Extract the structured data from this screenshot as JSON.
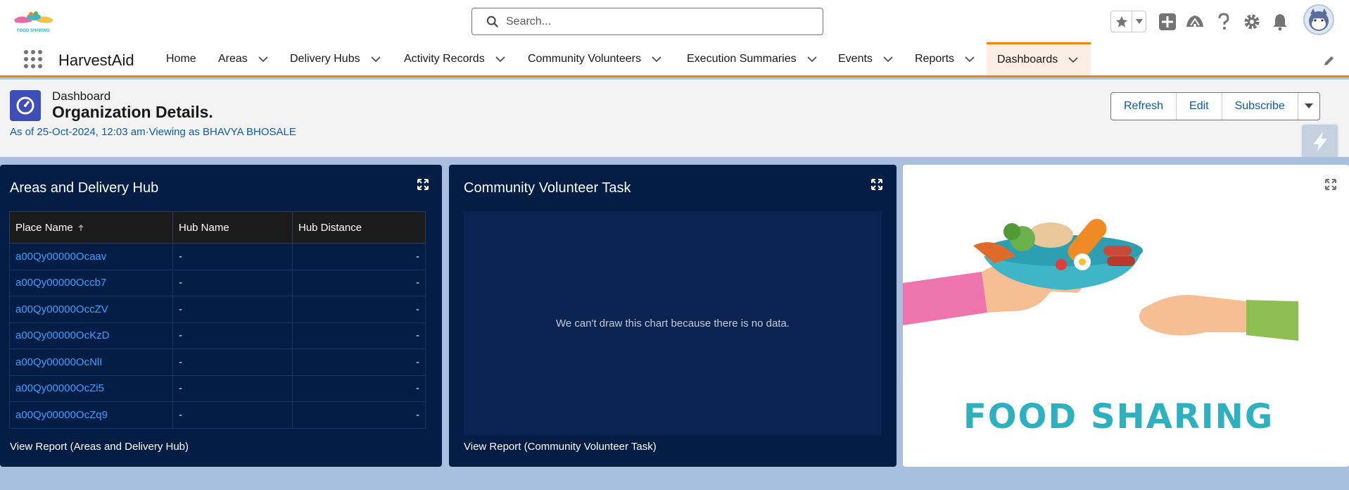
{
  "header": {
    "logo_text": "FOOD SHARING",
    "search_placeholder": "Search..."
  },
  "nav": {
    "app_name": "HarvestAid",
    "items": [
      {
        "label": "Home",
        "has_menu": false
      },
      {
        "label": "Areas",
        "has_menu": true
      },
      {
        "label": "Delivery Hubs",
        "has_menu": true
      },
      {
        "label": "Activity Records",
        "has_menu": true
      },
      {
        "label": "Community Volunteers",
        "has_menu": true
      },
      {
        "label": "Execution Summaries",
        "has_menu": true
      },
      {
        "label": "Events",
        "has_menu": true
      },
      {
        "label": "Reports",
        "has_menu": true
      },
      {
        "label": "Dashboards",
        "has_menu": true,
        "active": true
      }
    ]
  },
  "dashboard": {
    "type_label": "Dashboard",
    "title": "Organization Details.",
    "meta": "As of 25-Oct-2024, 12:03 am·Viewing as BHAVYA BHOSALE",
    "buttons": {
      "refresh": "Refresh",
      "edit": "Edit",
      "subscribe": "Subscribe"
    }
  },
  "panels": {
    "areas": {
      "title": "Areas and Delivery Hub",
      "columns": [
        "Place Name",
        "Hub Name",
        "Hub Distance"
      ],
      "rows": [
        [
          "a00Qy00000Ocaav",
          "-",
          "-"
        ],
        [
          "a00Qy00000Occb7",
          "-",
          "-"
        ],
        [
          "a00Qy00000OccZV",
          "-",
          "-"
        ],
        [
          "a00Qy00000OcKzD",
          "-",
          "-"
        ],
        [
          "a00Qy00000OcNlI",
          "-",
          "-"
        ],
        [
          "a00Qy00000OcZi5",
          "-",
          "-"
        ],
        [
          "a00Qy00000OcZq9",
          "-",
          "-"
        ]
      ],
      "footer": "View Report (Areas and Delivery Hub)"
    },
    "volunteer": {
      "title": "Community Volunteer Task",
      "empty_message": "We can't draw this chart because there is no data.",
      "footer": "View Report (Community Volunteer Task)"
    },
    "image": {
      "caption": "FOOD SHARING"
    }
  },
  "colors": {
    "accent": "#f38303",
    "panel_bg": "#031d45",
    "link": "#0b5cab",
    "table_link": "#3aa0ff"
  }
}
